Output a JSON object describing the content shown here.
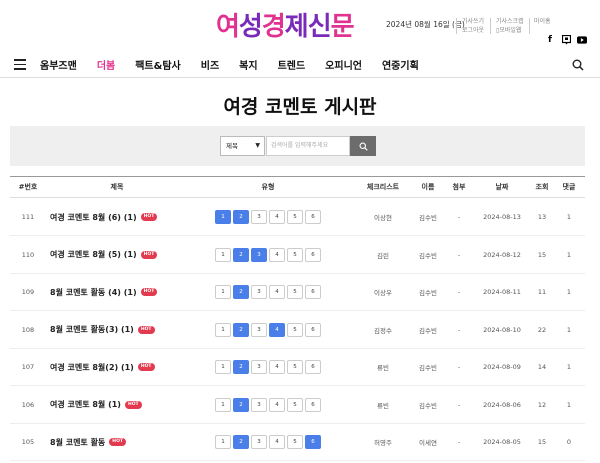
{
  "header": {
    "logo_chars": [
      {
        "ch": "여",
        "color": "#e0338f"
      },
      {
        "ch": "성",
        "color": "#7a2ab8"
      },
      {
        "ch": "경",
        "color": "#e0338f"
      },
      {
        "ch": "제",
        "color": "#7a2ab8"
      },
      {
        "ch": "신",
        "color": "#7a2ab8"
      },
      {
        "ch": "문",
        "color": "#e0338f"
      }
    ],
    "date": "2024년 08월 16일 (금)",
    "links_col1": [
      "기사쓰기",
      "로그아웃"
    ],
    "links_col2": [
      "기사스크랩",
      "모바일웹"
    ],
    "links_col3": [
      "마이홈"
    ],
    "social_icons": [
      "facebook-icon",
      "naver-post-icon",
      "youtube-icon"
    ]
  },
  "nav": {
    "items": [
      "옴부즈맨",
      "더봄",
      "팩트&탐사",
      "비즈",
      "복지",
      "트렌드",
      "오피니언",
      "연중기획"
    ],
    "active_index": 1
  },
  "page": {
    "title": "여경 코멘토 게시판"
  },
  "search": {
    "select_value": "제목",
    "placeholder": "검색어를 입력해주세요"
  },
  "table": {
    "headers": {
      "num": "#번호",
      "title": "제목",
      "type": "유형",
      "checklist": "체크리스트",
      "name": "이름",
      "attach": "첨부",
      "date": "날짜",
      "views": "조회",
      "comments": "댓글"
    },
    "hot_label": "HOT",
    "step_labels": [
      "1",
      "2",
      "3",
      "4",
      "5",
      "6"
    ],
    "rows": [
      {
        "num": "111",
        "title": "여경 코멘토 8월 (6) (1)",
        "steps_on": [
          0,
          1
        ],
        "checklist": "이상현",
        "name": "김수빈",
        "attach": "-",
        "date": "2024-08-13",
        "views": "13",
        "comments": "1"
      },
      {
        "num": "110",
        "title": "여경 코멘토 8월 (5) (1)",
        "steps_on": [
          1,
          2
        ],
        "checklist": "김린",
        "name": "김수빈",
        "attach": "-",
        "date": "2024-08-12",
        "views": "15",
        "comments": "1"
      },
      {
        "num": "109",
        "title": "8월 코멘토 활동 (4) (1)",
        "steps_on": [
          1
        ],
        "checklist": "이상우",
        "name": "김수빈",
        "attach": "-",
        "date": "2024-08-11",
        "views": "11",
        "comments": "1"
      },
      {
        "num": "108",
        "title": "8월 코멘토 활동(3) (1)",
        "steps_on": [
          1,
          3
        ],
        "checklist": "김정수",
        "name": "김수빈",
        "attach": "-",
        "date": "2024-08-10",
        "views": "22",
        "comments": "1"
      },
      {
        "num": "107",
        "title": "여경 코멘토 8월(2) (1)",
        "steps_on": [
          1
        ],
        "checklist": "류빈",
        "name": "김수빈",
        "attach": "-",
        "date": "2024-08-09",
        "views": "14",
        "comments": "1"
      },
      {
        "num": "106",
        "title": "여경 코멘토 8월 (1)",
        "steps_on": [
          1
        ],
        "checklist": "류빈",
        "name": "김수빈",
        "attach": "-",
        "date": "2024-08-06",
        "views": "12",
        "comments": "1"
      },
      {
        "num": "105",
        "title": "8월 코멘토 활동",
        "steps_on": [
          1,
          5
        ],
        "checklist": "허영주",
        "name": "이세연",
        "attach": "-",
        "date": "2024-08-05",
        "views": "15",
        "comments": "0"
      }
    ]
  },
  "colors": {
    "accent_pink": "#e0338f",
    "step_active": "#4a7ee8",
    "hot_badge": "#e23a4f"
  }
}
